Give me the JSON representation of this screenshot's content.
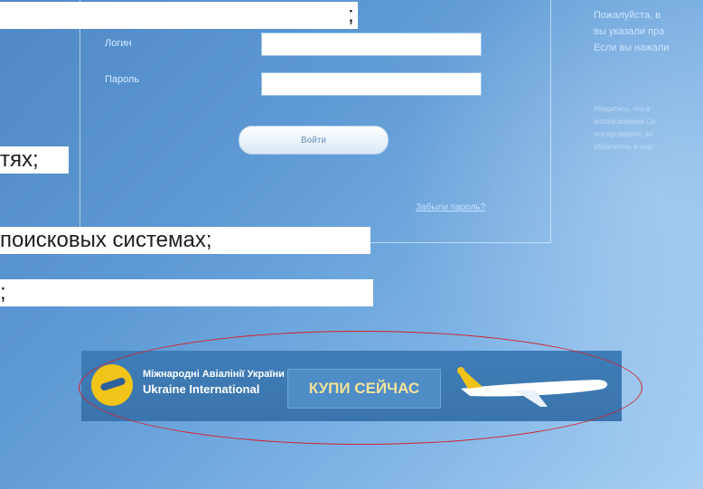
{
  "slide": {
    "bullets": [
      ";",
      "тях;",
      "поисковых системах;",
      ";"
    ]
  },
  "login": {
    "login_label": "Логин",
    "password_label": "Пароль",
    "submit_label": "Войти",
    "forgot_link": "Забыли пароль?"
  },
  "info": {
    "line1": "Пожалуйста, в",
    "line2": "вы указали пра",
    "line3": "Если вы нажали",
    "small1": "Убедитесь, что в",
    "small2": "использовании Ca",
    "small3": "это проверить, за",
    "small4": "обратитесь в наш"
  },
  "banner": {
    "brand_line1": "Міжнародні Авіалінії України",
    "brand_line2": "Ukraine International",
    "buy_button": "КУПИ СЕЙЧАС",
    "colors": {
      "logo": "#f0c419",
      "button_text": "#f3e39a",
      "highlight": "#d0232a"
    }
  }
}
